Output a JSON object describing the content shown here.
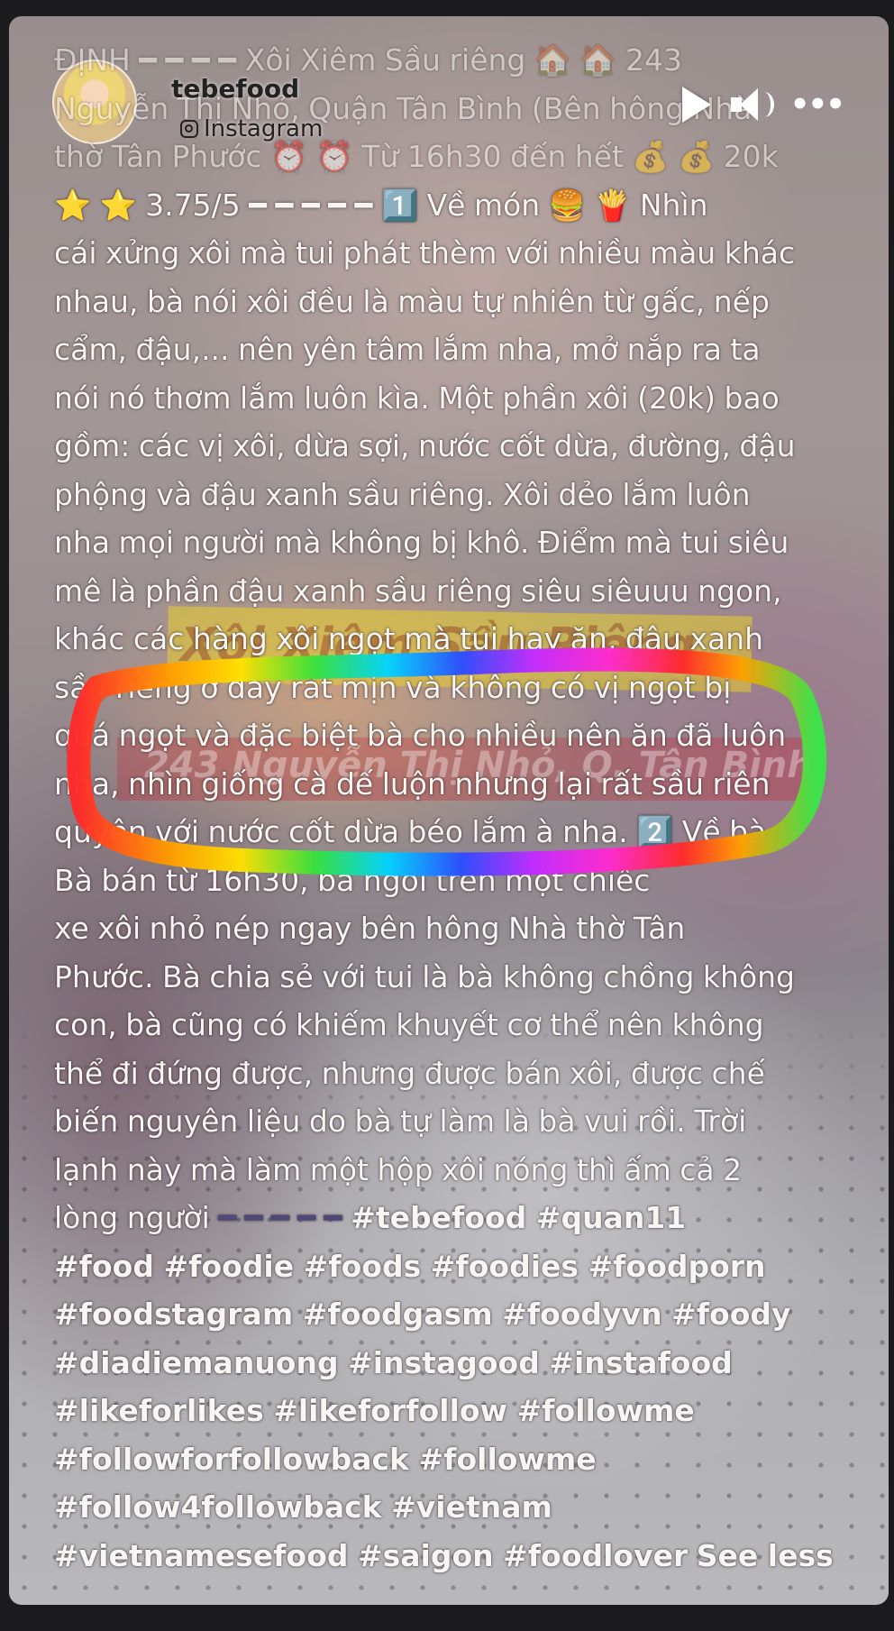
{
  "header": {
    "username": "tebefood",
    "source": "Instagram"
  },
  "controls": {
    "more": "•••"
  },
  "overlay": {
    "sign_text": "Xôi Xiêm Sầu Riêng",
    "band_text": "243 Nguyễn Thị Nhỏ, Q. Tân Bình"
  },
  "caption": {
    "lines": [
      "ĐỊNH ━ ━ ━ ━ Xôi Xiêm Sầu riêng 🏠 🏠 243",
      "Nguyễn Thị Nhỏ, Quận Tân Bình (Bên hông Nhà",
      "thờ Tân Phước ⏰ ⏰ Từ 16h30 đến hết 💰 💰 20k",
      "⭐ ⭐ 3.75/5 ━ ━ ━ ━ ━ 1️⃣ Về món 🍔 🍟 Nhìn",
      "cái xửng xôi mà tui phát thèm với nhiều màu khác",
      "nhau, bà nói xôi đều là màu tự nhiên từ gấc, nếp",
      "cẩm, đậu,... nên yên tâm lắm nha, mở nắp ra ta",
      "nói nó thơm lắm luôn kìa. Một phần xôi (20k) bao",
      "gồm: các vị xôi, dừa sợi, nước cốt dừa, đường, đậu",
      "phộng và đậu xanh sầu riêng. Xôi dẻo lắm luôn",
      "nha mọi người mà không bị khô. Điểm mà tui siêu",
      "mê là phần đậu xanh sầu riêng siêu siêuuu ngon,",
      "khác các hàng xôi ngọt mà tui hay ăn, đậu xanh",
      "sầu riêng ở đây rất mịn và không có vị ngọt bị",
      "quá ngọt và đặc biệt bà cho nhiều nên ăn đã luôn",
      "nha, nhìn giống cà dế luộn nhưng lại rất sầu riên",
      "quyện với nước cốt dừa béo lắm à nha. 2️⃣ Về bà",
      "Bà bán từ 16h30, bà ngồi trên một chiếc",
      "xe xôi nhỏ nép ngay bên hông Nhà thờ Tân",
      "Phước. Bà chia sẻ với tui là bà không chồng không",
      "con, bà cũng có khiếm khuyết cơ thể nên không",
      "thể đi đứng được, nhưng được bán xôi, được chế",
      "biến nguyên liệu do bà tự làm là bà vui rồi. Trời",
      "lạnh này mà làm một hộp xôi nóng thì ấm cả 2",
      "lòng người"
    ],
    "last_line_dashes": "━ ━ ━ ━ ━",
    "hashtag_lines": [
      "#tebefood #quan11",
      "#food #foodie #foods #foodies #foodporn",
      "#foodstagram #foodgasm #foodyvn #foody",
      "#diadiemanuong #instagood #instafood",
      "#likeforlikes #likeforfollow #followme",
      "#followforfollowback #followme",
      "#follow4followback #vietnam",
      "#vietnamesefood #saigon #foodlover"
    ],
    "see_less": "See less"
  }
}
